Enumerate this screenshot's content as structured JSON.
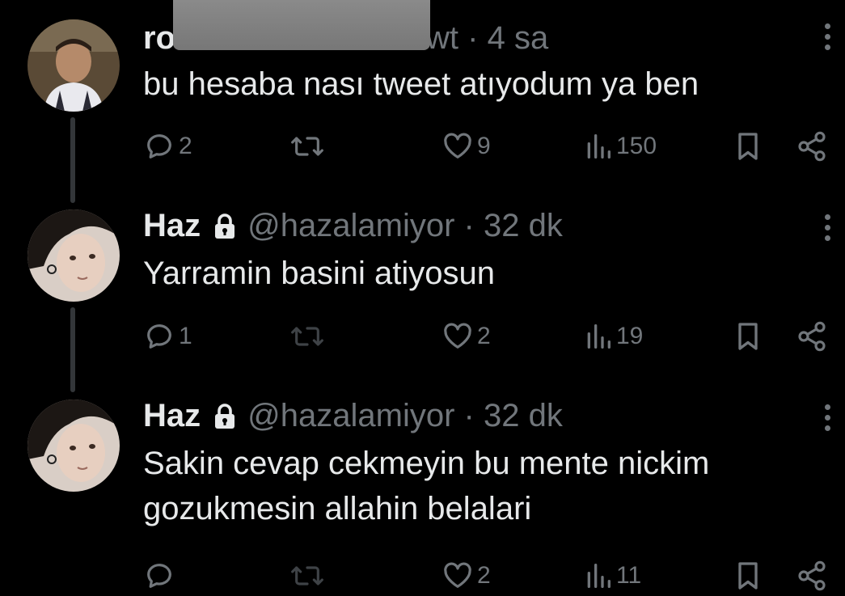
{
  "colors": {
    "background": "#000000",
    "text": "#e7e9ea",
    "muted": "#71767b",
    "thread_line": "#333639"
  },
  "tweets": [
    {
      "name": "ro",
      "handle_fragment": "wt",
      "separator": "·",
      "time": "4 sa",
      "text": "bu hesaba nası tweet atıyodum ya ben",
      "locked": false,
      "stats": {
        "replies": "2",
        "retweets": "",
        "likes": "9",
        "views": "150"
      }
    },
    {
      "name": "Haz",
      "handle": "@hazalamiyor",
      "separator": "·",
      "time": "32 dk",
      "text": "Yarramin basini atiyosun",
      "locked": true,
      "stats": {
        "replies": "1",
        "retweets": "",
        "likes": "2",
        "views": "19"
      }
    },
    {
      "name": "Haz",
      "handle": "@hazalamiyor",
      "separator": "·",
      "time": "32 dk",
      "text": "Sakin cevap cekmeyin bu mente nickim gozukmesin allahin belalari",
      "locked": true,
      "stats": {
        "replies": "",
        "retweets": "",
        "likes": "2",
        "views": "11"
      }
    }
  ]
}
